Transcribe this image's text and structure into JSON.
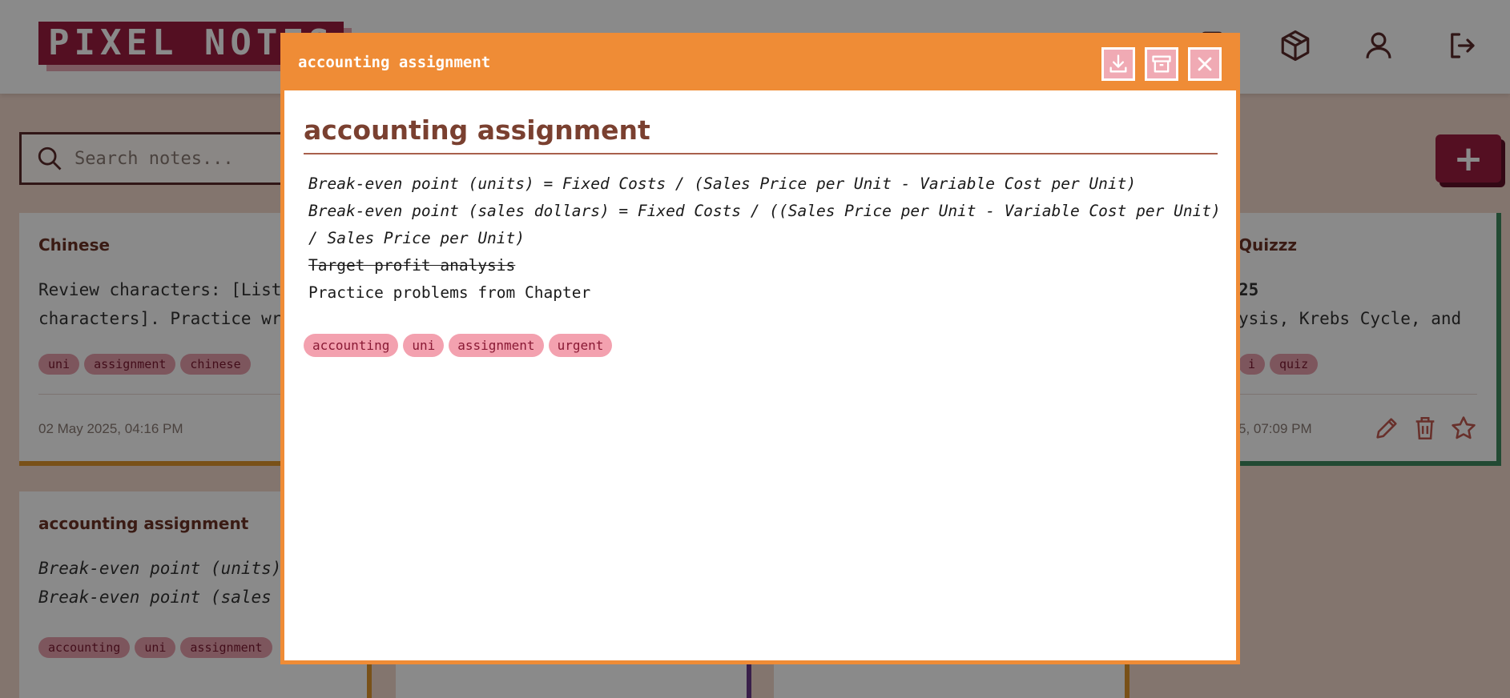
{
  "app": {
    "logo_text": "PIXEL NOTES"
  },
  "search": {
    "placeholder": "Search notes..."
  },
  "toolbar": {
    "add_label": "+"
  },
  "cards": [
    {
      "title": "Chinese",
      "body": "Review characters: [List characters]. Practice writing them. Complete the exercises",
      "tags": [
        "uni",
        "assignment",
        "chinese"
      ],
      "date": "02 May 2025, 04:16 PM",
      "accent": "#e0962e"
    },
    {
      "title": "Quizzz",
      "body_line1": "25",
      "body_line2": "ysis, Krebs Cycle, and",
      "tags": [
        "i",
        "quiz"
      ],
      "date": "5, 07:09 PM",
      "accent": "#3f8a5e"
    },
    {
      "title": "accounting assignment",
      "body": "Break-even point (units) Break-even point (sales dollars) = Fixed Costs",
      "tags": [
        "accounting",
        "uni",
        "assignment"
      ],
      "accent": "#e0962e"
    }
  ],
  "modal": {
    "header_title": "accounting assignment",
    "title": "accounting assignment",
    "lines": [
      "Break-even point (units) = Fixed Costs / (Sales Price per Unit - Variable Cost per Unit)",
      "Break-even point (sales dollars) = Fixed Costs / ((Sales Price per Unit - Variable Cost per Unit)",
      "/ Sales Price per Unit)",
      "Target profit analysis",
      "Practice problems from Chapter"
    ],
    "tags": [
      "accounting",
      "uni",
      "assignment",
      "urgent"
    ],
    "accent": "#ef8c36"
  },
  "colors": {
    "brand": "#9b1c3f",
    "tag_bg": "#f3a1af",
    "title_brown": "#7a4030"
  }
}
